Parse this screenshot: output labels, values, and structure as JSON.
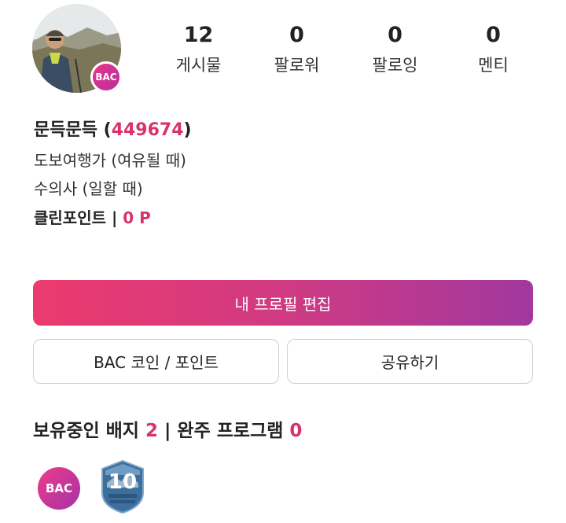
{
  "profile": {
    "avatar_badge": "BAC",
    "name": "문득문득",
    "user_id": "449674",
    "bio_lines": [
      "도보여행가 (여유될 때)",
      "수의사 (일할 때)"
    ],
    "clean_point_label": "클린포인트",
    "clean_point_value": "0 P"
  },
  "stats": [
    {
      "value": "12",
      "label": "게시물"
    },
    {
      "value": "0",
      "label": "팔로워"
    },
    {
      "value": "0",
      "label": "팔로잉"
    },
    {
      "value": "0",
      "label": "멘티"
    }
  ],
  "buttons": {
    "edit_profile": "내 프로필 편집",
    "coin_point": "BAC 코인 / 포인트",
    "share": "공유하기"
  },
  "badges_section": {
    "badges_label": "보유중인 배지",
    "badges_count": "2",
    "programs_label": "완주 프로그램",
    "programs_count": "0",
    "badges": [
      {
        "name": "bac-logo-badge",
        "text": "BAC"
      },
      {
        "name": "ten-mountain-shield-badge",
        "text": "10"
      }
    ]
  },
  "colors": {
    "accent": "#d8336f",
    "gradient_start": "#ec3a6e",
    "gradient_end": "#a1389e"
  }
}
